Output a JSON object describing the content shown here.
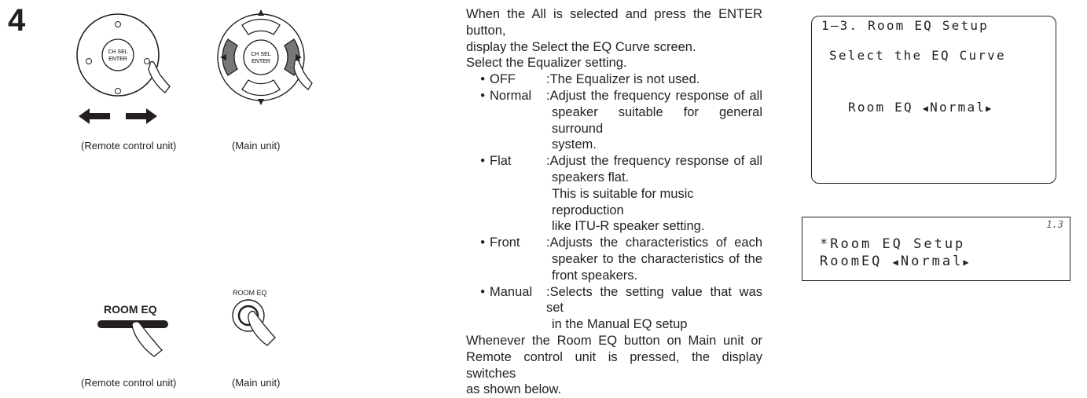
{
  "step": {
    "number": "4"
  },
  "figures": {
    "remote_top": {
      "knob_label_1": "CH SEL",
      "knob_label_2": "ENTER",
      "caption": "(Remote control unit)"
    },
    "main_top": {
      "knob_label_1": "CH SEL",
      "knob_label_2": "ENTER",
      "caption": "(Main unit)"
    },
    "remote_bottom": {
      "button_label": "ROOM EQ",
      "caption": "(Remote control unit)"
    },
    "main_bottom": {
      "button_label": "ROOM EQ",
      "caption": "(Main unit)"
    }
  },
  "instructions": {
    "intro_line1": "When the All is selected and press the ENTER button,",
    "intro_line2": "display the Select the EQ Curve screen.",
    "intro_line3": "Select the Equalizer setting.",
    "options": [
      {
        "name": "OFF",
        "lines": [
          ":The Equalizer is not used."
        ]
      },
      {
        "name": "Normal",
        "lines": [
          ":Adjust the frequency response of all",
          "speaker suitable for general surround",
          "system."
        ]
      },
      {
        "name": "Flat",
        "lines": [
          ":Adjust the frequency response of all",
          "speakers flat.",
          "This is suitable for music reproduction",
          "like ITU-R speaker setting."
        ]
      },
      {
        "name": "Front",
        "lines": [
          ":Adjusts the characteristics of each",
          "speaker to the characteristics of the",
          "front speakers."
        ]
      },
      {
        "name": "Manual",
        "lines": [
          ":Selects the setting value that was set",
          "in the Manual EQ setup"
        ]
      }
    ],
    "outro_line1": "Whenever the Room EQ button on Main unit or",
    "outro_line2": "Remote control unit is pressed, the display switches",
    "outro_line3": "as shown below."
  },
  "osd_screen": {
    "title": "1–3. Room EQ Setup",
    "subtitle": "Select the EQ Curve",
    "setting_label": "Room EQ",
    "setting_value": "Normal"
  },
  "front_display": {
    "index": "1.3",
    "line1": "*Room EQ Setup",
    "line2_label": "RoomEQ",
    "line2_value": "Normal"
  }
}
